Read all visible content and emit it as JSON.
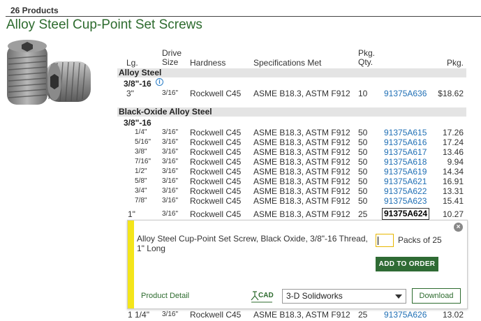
{
  "header": {
    "count": "26 Products",
    "title": "Alloy Steel Cup-Point Set Screws"
  },
  "columns": {
    "length": "Lg.",
    "drive_size": "Drive Size",
    "hardness": "Hardness",
    "specs": "Specifications Met",
    "pkg_qty": "Pkg. Qty.",
    "pkg": "Pkg."
  },
  "groups": {
    "alloy": {
      "name": "Alloy Steel",
      "thread": "3/8\"-16",
      "rows": [
        {
          "len": "3\"",
          "drive": "3/16\"",
          "hard": "Rockwell C45",
          "spec": "ASME B18.3, ASTM F912",
          "qty": "10",
          "part": "91375A636",
          "price": "$18.62"
        }
      ]
    },
    "black": {
      "name": "Black-Oxide Alloy Steel",
      "thread": "3/8\"-16",
      "rows": [
        {
          "len": "1/4\"",
          "drive": "3/16\"",
          "hard": "Rockwell C45",
          "spec": "ASME B18.3, ASTM F912",
          "qty": "50",
          "part": "91375A615",
          "price": "17.26"
        },
        {
          "len": "5/16\"",
          "drive": "3/16\"",
          "hard": "Rockwell C45",
          "spec": "ASME B18.3, ASTM F912",
          "qty": "50",
          "part": "91375A616",
          "price": "17.24"
        },
        {
          "len": "3/8\"",
          "drive": "3/16\"",
          "hard": "Rockwell C45",
          "spec": "ASME B18.3, ASTM F912",
          "qty": "50",
          "part": "91375A617",
          "price": "13.46"
        },
        {
          "len": "7/16\"",
          "drive": "3/16\"",
          "hard": "Rockwell C45",
          "spec": "ASME B18.3, ASTM F912",
          "qty": "50",
          "part": "91375A618",
          "price": "9.94"
        },
        {
          "len": "1/2\"",
          "drive": "3/16\"",
          "hard": "Rockwell C45",
          "spec": "ASME B18.3, ASTM F912",
          "qty": "50",
          "part": "91375A619",
          "price": "14.34"
        },
        {
          "len": "5/8\"",
          "drive": "3/16\"",
          "hard": "Rockwell C45",
          "spec": "ASME B18.3, ASTM F912",
          "qty": "50",
          "part": "91375A621",
          "price": "16.91"
        },
        {
          "len": "3/4\"",
          "drive": "3/16\"",
          "hard": "Rockwell C45",
          "spec": "ASME B18.3, ASTM F912",
          "qty": "50",
          "part": "91375A622",
          "price": "13.31"
        },
        {
          "len": "7/8\"",
          "drive": "3/16\"",
          "hard": "Rockwell C45",
          "spec": "ASME B18.3, ASTM F912",
          "qty": "50",
          "part": "91375A623",
          "price": "15.41"
        },
        {
          "len": "1\"",
          "drive": "3/16\"",
          "hard": "Rockwell C45",
          "spec": "ASME B18.3, ASTM F912",
          "qty": "25",
          "part": "91375A624",
          "price": "10.27"
        },
        {
          "len": "1 1/4\"",
          "drive": "3/16\"",
          "hard": "Rockwell C45",
          "spec": "ASME B18.3, ASTM F912",
          "qty": "25",
          "part": "91375A626",
          "price": "13.02"
        }
      ]
    }
  },
  "popup": {
    "description": "Alloy Steel Cup-Point Set Screw, Black Oxide, 3/8\"-16 Thread, 1\" Long",
    "packs_label": "Packs of 25",
    "add_to_order": "ADD TO ORDER",
    "product_detail": "Product Detail",
    "cad_label": "CAD",
    "cad_format": "3-D Solidworks",
    "download": "Download",
    "close": "×"
  },
  "colors": {
    "title_green": "#2d6b2e",
    "link_blue": "#1f6fb5",
    "button_green": "#2f6b34",
    "accent_yellow": "#f4e51a"
  }
}
